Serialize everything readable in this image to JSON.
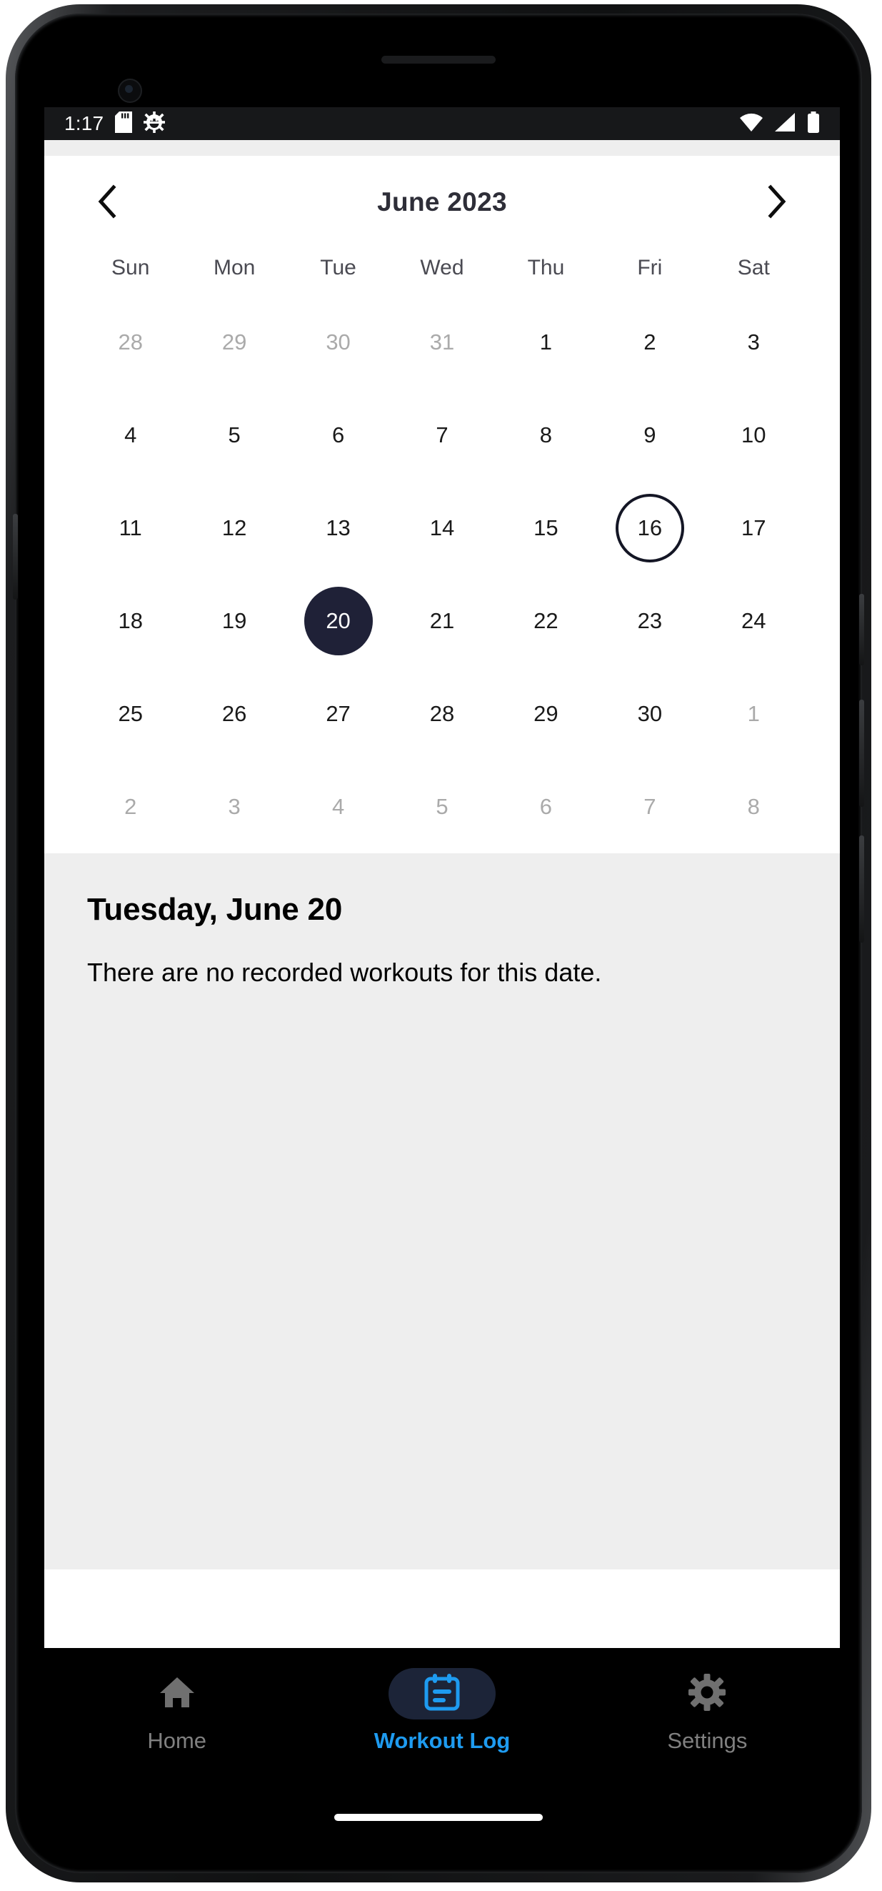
{
  "status_bar": {
    "clock": "1:17",
    "left_icons": [
      "sd-card-icon",
      "android-debug-icon"
    ],
    "right_icons": [
      "wifi-icon",
      "cellular-signal-icon",
      "battery-icon"
    ]
  },
  "calendar": {
    "title": "June 2023",
    "prev_label": "‹",
    "next_label": "›",
    "weekdays": [
      "Sun",
      "Mon",
      "Tue",
      "Wed",
      "Thu",
      "Fri",
      "Sat"
    ],
    "days": [
      {
        "label": "28",
        "state": "muted"
      },
      {
        "label": "29",
        "state": "muted"
      },
      {
        "label": "30",
        "state": "muted"
      },
      {
        "label": "31",
        "state": "muted"
      },
      {
        "label": "1",
        "state": "normal"
      },
      {
        "label": "2",
        "state": "normal"
      },
      {
        "label": "3",
        "state": "normal"
      },
      {
        "label": "4",
        "state": "normal"
      },
      {
        "label": "5",
        "state": "normal"
      },
      {
        "label": "6",
        "state": "normal"
      },
      {
        "label": "7",
        "state": "normal"
      },
      {
        "label": "8",
        "state": "normal"
      },
      {
        "label": "9",
        "state": "normal"
      },
      {
        "label": "10",
        "state": "normal"
      },
      {
        "label": "11",
        "state": "normal"
      },
      {
        "label": "12",
        "state": "normal"
      },
      {
        "label": "13",
        "state": "normal"
      },
      {
        "label": "14",
        "state": "normal"
      },
      {
        "label": "15",
        "state": "normal"
      },
      {
        "label": "16",
        "state": "today"
      },
      {
        "label": "17",
        "state": "normal"
      },
      {
        "label": "18",
        "state": "normal"
      },
      {
        "label": "19",
        "state": "normal"
      },
      {
        "label": "20",
        "state": "selected"
      },
      {
        "label": "21",
        "state": "normal"
      },
      {
        "label": "22",
        "state": "normal"
      },
      {
        "label": "23",
        "state": "normal"
      },
      {
        "label": "24",
        "state": "normal"
      },
      {
        "label": "25",
        "state": "normal"
      },
      {
        "label": "26",
        "state": "normal"
      },
      {
        "label": "27",
        "state": "normal"
      },
      {
        "label": "28",
        "state": "normal"
      },
      {
        "label": "29",
        "state": "normal"
      },
      {
        "label": "30",
        "state": "normal"
      },
      {
        "label": "1",
        "state": "muted"
      },
      {
        "label": "2",
        "state": "muted"
      },
      {
        "label": "3",
        "state": "muted"
      },
      {
        "label": "4",
        "state": "muted"
      },
      {
        "label": "5",
        "state": "muted"
      },
      {
        "label": "6",
        "state": "muted"
      },
      {
        "label": "7",
        "state": "muted"
      },
      {
        "label": "8",
        "state": "muted"
      }
    ]
  },
  "detail": {
    "date_title": "Tuesday, June 20",
    "empty_message": "There are no recorded workouts for this date."
  },
  "bottom_nav": {
    "items": [
      {
        "label": "Home",
        "icon": "home-icon",
        "active": false
      },
      {
        "label": "Workout Log",
        "icon": "workout-log-calendar-icon",
        "active": true
      },
      {
        "label": "Settings",
        "icon": "gear-icon",
        "active": false
      }
    ]
  },
  "colors": {
    "accent_blue": "#1e9bf0",
    "selected_day": "#1f2137",
    "panel_gray": "#eeeeee",
    "muted_text": "#aaaaaa",
    "nav_inactive": "#808080"
  }
}
